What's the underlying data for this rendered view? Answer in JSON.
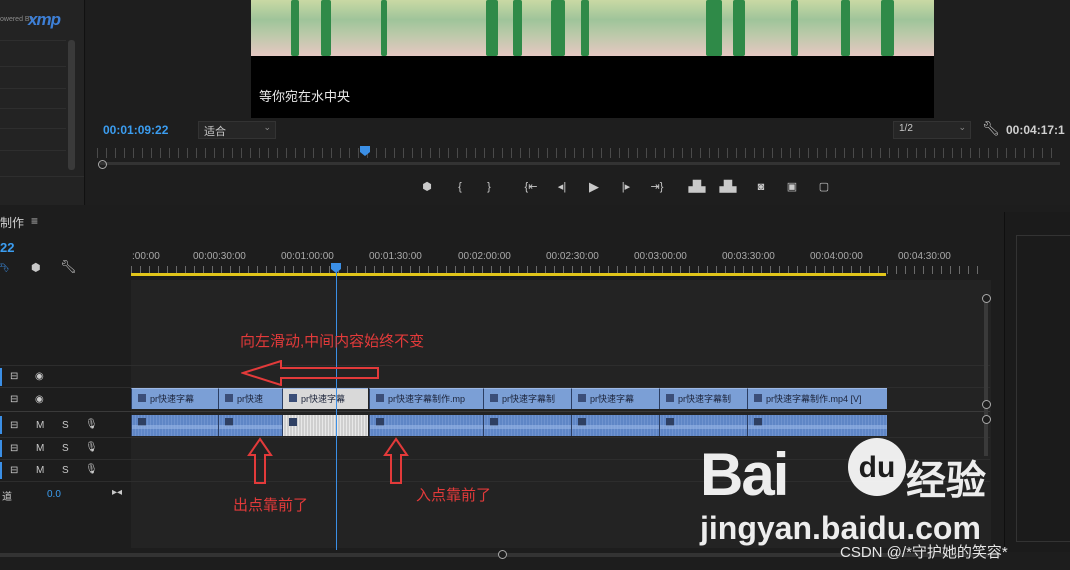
{
  "monitor": {
    "brand_prefix": "owered By",
    "brand_logo": "xmp",
    "subtitle": "等你宛在水中央",
    "current_timecode": "00:01:09:22",
    "fit_value": "适合",
    "resolution_value": "1/2",
    "duration_timecode": "00:04:17:1",
    "playhead_fraction": 0.285,
    "transport": [
      "marker-icon",
      "mark-in-icon",
      "mark-out-icon",
      "go-to-in-icon",
      "step-back-icon",
      "play-icon",
      "step-forward-icon",
      "go-to-out-icon",
      "lift-icon",
      "extract-icon",
      "camera-icon",
      "comparison-icon",
      "safe-margins-icon"
    ]
  },
  "timeline": {
    "sequence_tab": "制作",
    "sequence_timecode": "22",
    "track_label_partial": "道",
    "track_value": "0.0",
    "ruler_ticks": [
      ":00:00",
      "00:00:30:00",
      "00:01:00:00",
      "00:01:30:00",
      "00:02:00:00",
      "00:02:30:00",
      "00:03:00:00",
      "00:03:30:00",
      "00:04:00:00",
      "00:04:30:00"
    ],
    "video_clips": [
      {
        "label": "pr快速字幕",
        "selected": false
      },
      {
        "label": "pr快速",
        "selected": false
      },
      {
        "label": "pr快速字幕",
        "selected": true
      },
      {
        "label": "pr快速字幕制作.mp",
        "selected": false
      },
      {
        "label": "pr快速字幕制",
        "selected": false
      },
      {
        "label": "pr快速字幕",
        "selected": false
      },
      {
        "label": "pr快速字幕制",
        "selected": false
      },
      {
        "label": "pr快速字幕制作.mp4 [V]",
        "selected": false
      }
    ],
    "audio_track_buttons": {
      "mute": "M",
      "solo": "S"
    }
  },
  "annotations": {
    "slide_note": "向左滑动,中间内容始终不变",
    "out_point_note": "出点靠前了",
    "in_point_note": "入点靠前了",
    "color": "#e23a3a"
  },
  "watermark": {
    "baidu": "Bai",
    "du": "du",
    "jingyan": "经验",
    "url": "jingyan.baidu.com",
    "csdn": "CSDN @/*守护她的笑容*"
  }
}
